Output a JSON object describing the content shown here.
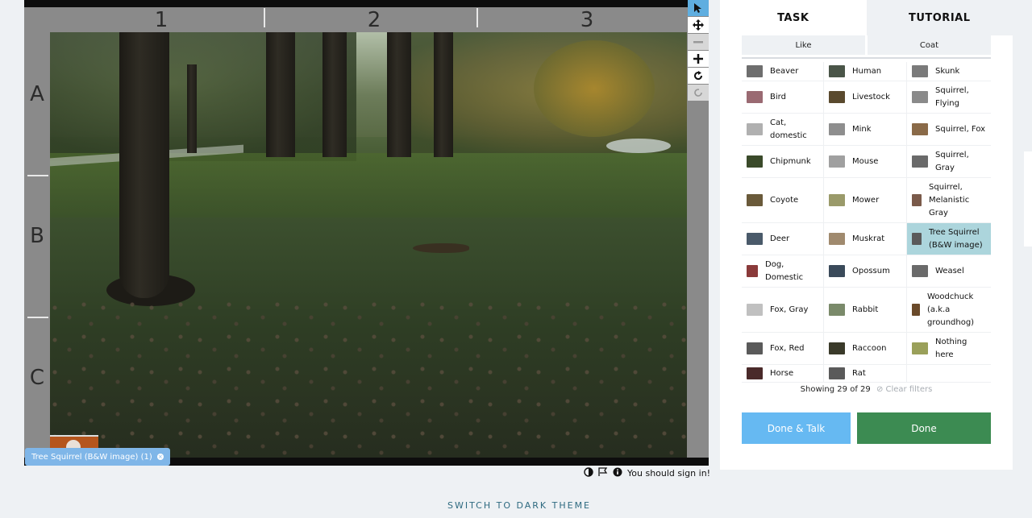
{
  "viewer": {
    "columns": [
      "1",
      "2",
      "3"
    ],
    "rows": [
      "A",
      "B",
      "C"
    ],
    "tag_chip": "Tree Squirrel (B&W image) (1)"
  },
  "toolbar": {
    "tools": [
      "pointer-icon",
      "move-icon",
      "zoom-out-icon",
      "zoom-in-icon",
      "rotate-icon",
      "reset-icon"
    ]
  },
  "meta": {
    "sign_in_text": "You should sign in!"
  },
  "panel": {
    "tabs": [
      "TASK",
      "TUTORIAL"
    ],
    "filters": [
      "Like",
      "Coat"
    ],
    "species": [
      {
        "label": "Beaver",
        "color": "#6e6e6e"
      },
      {
        "label": "Human",
        "color": "#4a5548"
      },
      {
        "label": "Skunk",
        "color": "#7a7a7a"
      },
      {
        "label": "Bird",
        "color": "#9a6a72"
      },
      {
        "label": "Livestock",
        "color": "#5a4a2e"
      },
      {
        "label": "Squirrel, Flying",
        "color": "#8a8a8a"
      },
      {
        "label": "Cat, domestic",
        "color": "#b0b0b0"
      },
      {
        "label": "Mink",
        "color": "#8e8e8e"
      },
      {
        "label": "Squirrel, Fox",
        "color": "#8a6a48"
      },
      {
        "label": "Chipmunk",
        "color": "#3a4a2a"
      },
      {
        "label": "Mouse",
        "color": "#a0a0a0"
      },
      {
        "label": "Squirrel, Gray",
        "color": "#6a6a6a"
      },
      {
        "label": "Coyote",
        "color": "#6a5a3a"
      },
      {
        "label": "Mower",
        "color": "#9a9a6a"
      },
      {
        "label": "Squirrel, Melanistic Gray",
        "color": "#7a5a4a"
      },
      {
        "label": "Deer",
        "color": "#4a5a6a"
      },
      {
        "label": "Muskrat",
        "color": "#a08a6e"
      },
      {
        "label": "Tree Squirrel (B&W image)",
        "color": "#5a5a5a"
      },
      {
        "label": "Dog, Domestic",
        "color": "#8a3a3a"
      },
      {
        "label": "Opossum",
        "color": "#3a4a5a"
      },
      {
        "label": "Weasel",
        "color": "#6a6a6a"
      },
      {
        "label": "Fox, Gray",
        "color": "#c0c0c0"
      },
      {
        "label": "Rabbit",
        "color": "#7a8a6a"
      },
      {
        "label": "Woodchuck (a.k.a groundhog)",
        "color": "#6a4a2a"
      },
      {
        "label": "Fox, Red",
        "color": "#5a5a5a"
      },
      {
        "label": "Raccoon",
        "color": "#3a3a2a"
      },
      {
        "label": "Nothing here",
        "color": "#9aa05a"
      },
      {
        "label": "Horse",
        "color": "#4a2a2a"
      },
      {
        "label": "Rat",
        "color": "#5a5a5a"
      }
    ],
    "showing": "Showing 29 of 29",
    "clear_filters": "Clear filters",
    "done_talk": "Done & Talk",
    "done": "Done"
  },
  "footer": {
    "theme_toggle": "SWITCH TO DARK THEME"
  }
}
